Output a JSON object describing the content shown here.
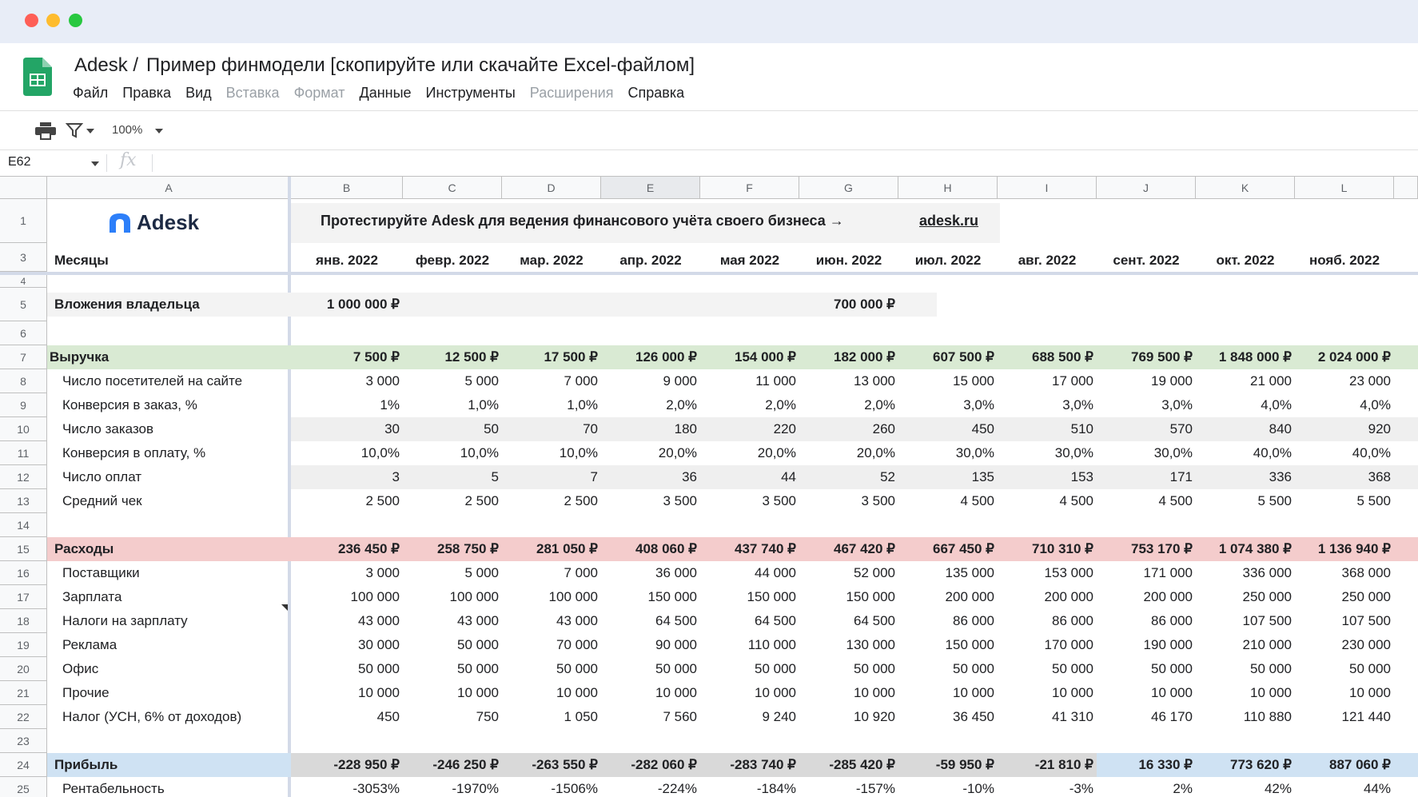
{
  "app": {
    "title_prefix": "Adesk /",
    "title": "Пример финмодели [скопируйте или скачайте Excel-файлом]",
    "menu": [
      {
        "label": "Файл",
        "enabled": true
      },
      {
        "label": "Правка",
        "enabled": true
      },
      {
        "label": "Вид",
        "enabled": true
      },
      {
        "label": "Вставка",
        "enabled": false
      },
      {
        "label": "Формат",
        "enabled": false
      },
      {
        "label": "Данные",
        "enabled": true
      },
      {
        "label": "Инструменты",
        "enabled": true
      },
      {
        "label": "Расширения",
        "enabled": false
      },
      {
        "label": "Справка",
        "enabled": true
      }
    ],
    "zoom": "100%",
    "name_box": "E62",
    "fx_label": "fx",
    "selected_column": "E"
  },
  "columns": [
    "A",
    "B",
    "C",
    "D",
    "E",
    "F",
    "G",
    "H",
    "I",
    "J",
    "K",
    "L"
  ],
  "banner": {
    "logo_text": "Adesk",
    "promo": "Протестируйте Adesk для ведения финансового учёта своего бизнеса  →",
    "link": "adesk.ru"
  },
  "months_label": "Месяцы",
  "months": [
    "янв. 2022",
    "февр. 2022",
    "мар. 2022",
    "апр. 2022",
    "мая 2022",
    "июн. 2022",
    "июл. 2022",
    "авг. 2022",
    "сент. 2022",
    "окт. 2022",
    "нояб. 2022"
  ],
  "rows": [
    {
      "num": "5",
      "label": "Вложения владельца",
      "style": "owner",
      "values": [
        "1 000 000 ₽",
        "",
        "",
        "",
        "",
        "700 000 ₽",
        "",
        "",
        "",
        "",
        ""
      ]
    },
    {
      "num": "6",
      "label": "",
      "style": "blank",
      "values": []
    },
    {
      "num": "7",
      "label": "Выручка",
      "style": "revenue",
      "values": [
        "7 500 ₽",
        "12 500 ₽",
        "17 500 ₽",
        "126 000 ₽",
        "154 000 ₽",
        "182 000 ₽",
        "607 500 ₽",
        "688 500 ₽",
        "769 500 ₽",
        "1 848 000 ₽",
        "2 024 000 ₽"
      ]
    },
    {
      "num": "8",
      "label": "Число посетителей на сайте",
      "style": "item",
      "values": [
        "3 000",
        "5 000",
        "7 000",
        "9 000",
        "11 000",
        "13 000",
        "15 000",
        "17 000",
        "19 000",
        "21 000",
        "23 000"
      ]
    },
    {
      "num": "9",
      "label": "Конверсия в заказ, %",
      "style": "item",
      "values": [
        "1%",
        "1,0%",
        "1,0%",
        "2,0%",
        "2,0%",
        "2,0%",
        "3,0%",
        "3,0%",
        "3,0%",
        "4,0%",
        "4,0%"
      ]
    },
    {
      "num": "10",
      "label": "Число заказов",
      "style": "item-alt",
      "values": [
        "30",
        "50",
        "70",
        "180",
        "220",
        "260",
        "450",
        "510",
        "570",
        "840",
        "920"
      ]
    },
    {
      "num": "11",
      "label": "Конверсия в оплату, %",
      "style": "item",
      "values": [
        "10,0%",
        "10,0%",
        "10,0%",
        "20,0%",
        "20,0%",
        "20,0%",
        "30,0%",
        "30,0%",
        "30,0%",
        "40,0%",
        "40,0%"
      ]
    },
    {
      "num": "12",
      "label": "Число оплат",
      "style": "item-alt",
      "values": [
        "3",
        "5",
        "7",
        "36",
        "44",
        "52",
        "135",
        "153",
        "171",
        "336",
        "368"
      ]
    },
    {
      "num": "13",
      "label": "Средний чек",
      "style": "item",
      "values": [
        "2 500",
        "2 500",
        "2 500",
        "3 500",
        "3 500",
        "3 500",
        "4 500",
        "4 500",
        "4 500",
        "5 500",
        "5 500"
      ]
    },
    {
      "num": "14",
      "label": "",
      "style": "blank",
      "values": []
    },
    {
      "num": "15",
      "label": "Расходы",
      "style": "expenses",
      "values": [
        "236 450 ₽",
        "258 750 ₽",
        "281 050 ₽",
        "408 060 ₽",
        "437 740 ₽",
        "467 420 ₽",
        "667 450 ₽",
        "710 310 ₽",
        "753 170 ₽",
        "1 074 380 ₽",
        "1 136 940 ₽"
      ]
    },
    {
      "num": "16",
      "label": "Поставщики",
      "style": "item",
      "values": [
        "3 000",
        "5 000",
        "7 000",
        "36 000",
        "44 000",
        "52 000",
        "135 000",
        "153 000",
        "171 000",
        "336 000",
        "368 000"
      ]
    },
    {
      "num": "17",
      "label": "Зарплата",
      "style": "item",
      "values": [
        "100 000",
        "100 000",
        "100 000",
        "150 000",
        "150 000",
        "150 000",
        "200 000",
        "200 000",
        "200 000",
        "250 000",
        "250 000"
      ]
    },
    {
      "num": "18",
      "label": "Налоги на зарплату",
      "style": "item",
      "values": [
        "43 000",
        "43 000",
        "43 000",
        "64 500",
        "64 500",
        "64 500",
        "86 000",
        "86 000",
        "86 000",
        "107 500",
        "107 500"
      ]
    },
    {
      "num": "19",
      "label": "Реклама",
      "style": "item",
      "values": [
        "30 000",
        "50 000",
        "70 000",
        "90 000",
        "110 000",
        "130 000",
        "150 000",
        "170 000",
        "190 000",
        "210 000",
        "230 000"
      ]
    },
    {
      "num": "20",
      "label": "Офис",
      "style": "item",
      "values": [
        "50 000",
        "50 000",
        "50 000",
        "50 000",
        "50 000",
        "50 000",
        "50 000",
        "50 000",
        "50 000",
        "50 000",
        "50 000"
      ]
    },
    {
      "num": "21",
      "label": "Прочие",
      "style": "item",
      "values": [
        "10 000",
        "10 000",
        "10 000",
        "10 000",
        "10 000",
        "10 000",
        "10 000",
        "10 000",
        "10 000",
        "10 000",
        "10 000"
      ]
    },
    {
      "num": "22",
      "label": "Налог (УСН, 6% от доходов)",
      "style": "item",
      "values": [
        "450",
        "750",
        "1 050",
        "7 560",
        "9 240",
        "10 920",
        "36 450",
        "41 310",
        "46 170",
        "110 880",
        "121 440"
      ]
    },
    {
      "num": "23",
      "label": "",
      "style": "blank",
      "values": []
    },
    {
      "num": "24",
      "label": "Прибыль",
      "style": "profit",
      "values": [
        "-228 950 ₽",
        "-246 250 ₽",
        "-263 550 ₽",
        "-282 060 ₽",
        "-283 740 ₽",
        "-285 420 ₽",
        "-59 950 ₽",
        "-21 810 ₽",
        "16 330 ₽",
        "773 620 ₽",
        "887 060 ₽"
      ]
    },
    {
      "num": "25",
      "label": "Рентабельность",
      "style": "item",
      "values": [
        "-3053%",
        "-1970%",
        "-1506%",
        "-224%",
        "-184%",
        "-157%",
        "-10%",
        "-3%",
        "2%",
        "42%",
        "44%"
      ]
    }
  ],
  "colors": {
    "revenue_band": "#d9ead3",
    "expenses_band": "#f4cccc",
    "profit_band": "#cfe2f3",
    "profit_negative_cell": "#d9d9d9",
    "owner_band": "#f3f3f3"
  }
}
